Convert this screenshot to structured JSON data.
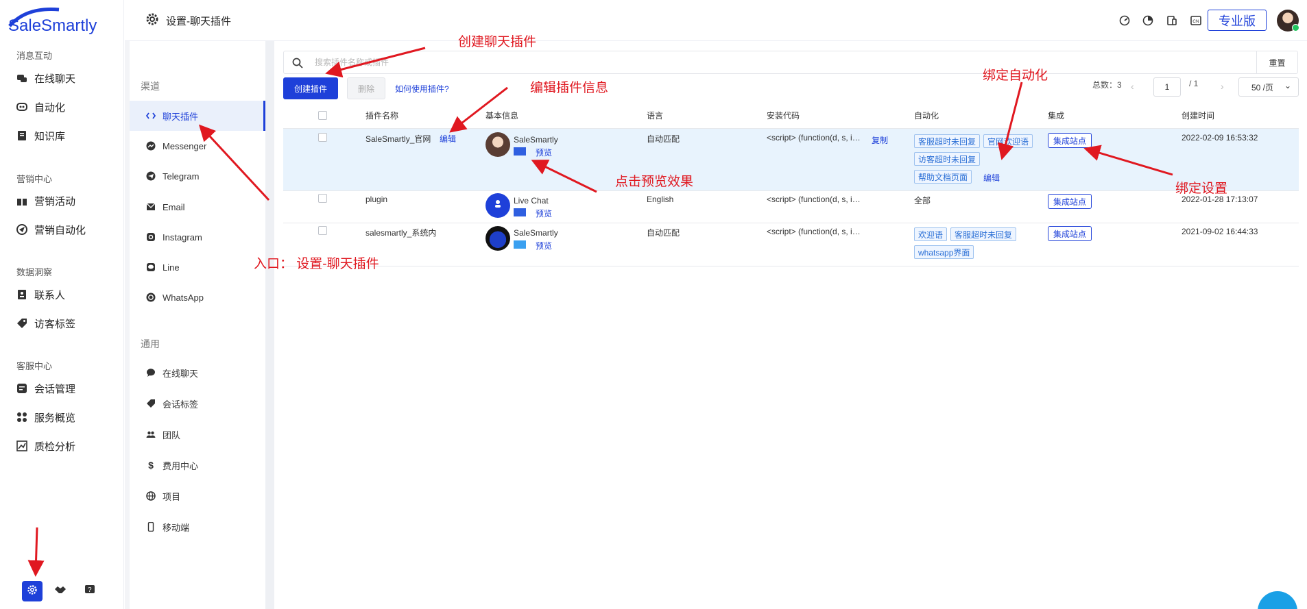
{
  "app": {
    "logo_text": "SaleSmartly"
  },
  "nav": {
    "sections": [
      {
        "label": "消息互动",
        "items": [
          "在线聊天",
          "自动化",
          "知识库"
        ]
      },
      {
        "label": "营销中心",
        "items": [
          "营销活动",
          "营销自动化"
        ]
      },
      {
        "label": "数据洞察",
        "items": [
          "联系人",
          "访客标签"
        ]
      },
      {
        "label": "客服中心",
        "items": [
          "会话管理",
          "服务概览",
          "质检分析"
        ]
      }
    ]
  },
  "topbar": {
    "title": "设置-聊天插件",
    "pro_label": "专业版"
  },
  "subnav": {
    "channel_label": "渠道",
    "channels": [
      "聊天插件",
      "Messenger",
      "Telegram",
      "Email",
      "Instagram",
      "Line",
      "WhatsApp"
    ],
    "general_label": "通用",
    "general": [
      "在线聊天",
      "会话标签",
      "团队",
      "费用中心",
      "项目",
      "移动端"
    ]
  },
  "toolbar": {
    "search_placeholder": "搜索插件名称或插件",
    "reset": "重置",
    "create": "创建插件",
    "delete": "删除",
    "howto": "如何使用插件?",
    "total": "总数：3",
    "page": "1",
    "page_sep": "/  1",
    "page_size": "50 /页"
  },
  "table": {
    "headers": [
      "插件名称",
      "基本信息",
      "语言",
      "安装代码",
      "自动化",
      "集成",
      "创建时间"
    ],
    "rows": [
      {
        "name": "SaleSmartly_官网",
        "edit": "编辑",
        "brand": "SaleSmartly",
        "preview": "预览",
        "lang": "自动匹配",
        "code": "<script> (function(d, s, i…",
        "copy": "复制",
        "tags": [
          "客服超时未回复",
          "官网欢迎语",
          "访客超时未回复",
          "帮助文档页面"
        ],
        "auto_edit": "编辑",
        "integrate": "集成站点",
        "created": "2022-02-09 16:53:32",
        "swatch": "#2f5fe0"
      },
      {
        "name": "plugin",
        "brand": "Live Chat",
        "preview": "预览",
        "lang": "English",
        "code": "<script> (function(d, s, i…",
        "auto_text": "全部",
        "integrate": "集成站点",
        "created": "2022-01-28 17:13:07",
        "swatch": "#2f5fe0"
      },
      {
        "name": "salesmartly_系统内",
        "brand": "SaleSmartly",
        "preview": "预览",
        "lang": "自动匹配",
        "code": "<script> (function(d, s, i…",
        "tags": [
          "欢迎语",
          "客服超时未回复",
          "whatsapp界面"
        ],
        "integrate": "集成站点",
        "created": "2021-09-02 16:44:33",
        "swatch": "#3aa0f0"
      }
    ]
  },
  "annotations": {
    "create": "创建聊天插件",
    "edit": "编辑插件信息",
    "auto": "绑定自动化",
    "preview": "点击预览效果",
    "bind": "绑定设置",
    "entry": "入口：  设置-聊天插件"
  },
  "colors": {
    "accent": "#1e40d9",
    "annotation": "#e01820"
  }
}
